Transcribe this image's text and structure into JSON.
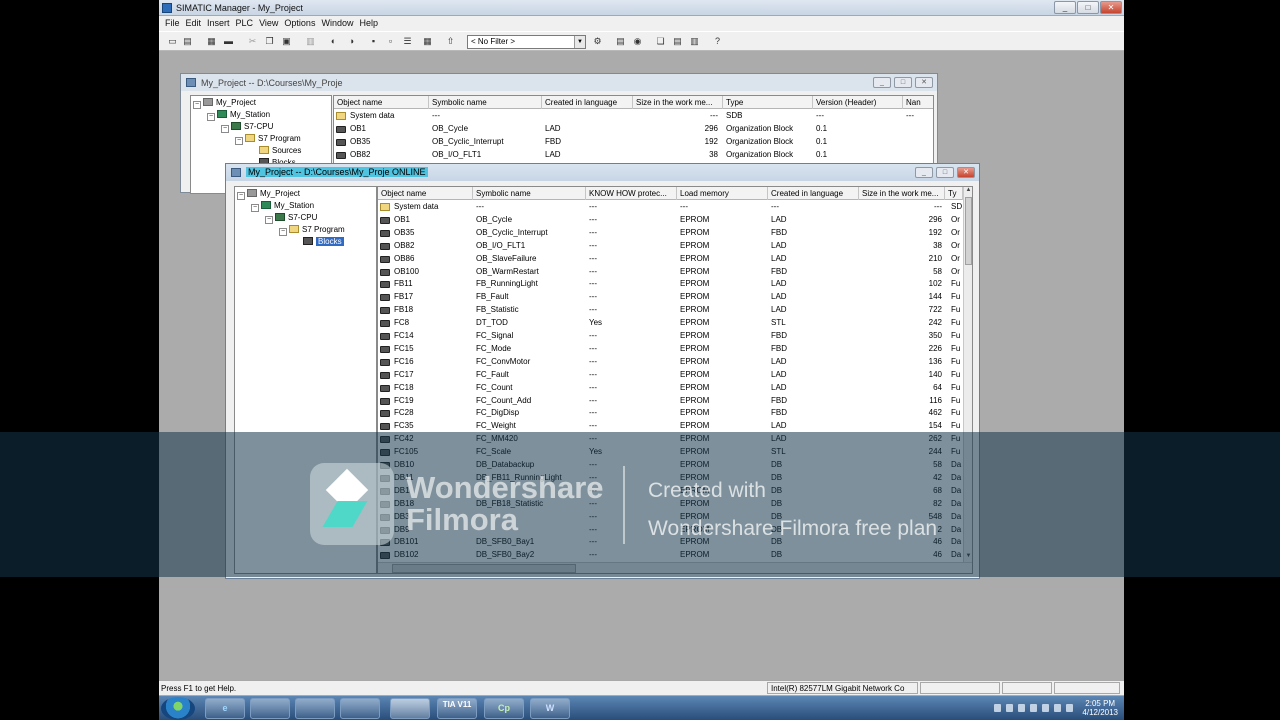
{
  "app": {
    "title": "SIMATIC Manager - My_Project",
    "min": "_",
    "max": "□",
    "close": "✕"
  },
  "menu": [
    "File",
    "Edit",
    "Insert",
    "PLC",
    "View",
    "Options",
    "Window",
    "Help"
  ],
  "toolbar": {
    "filter_value": "< No Filter >",
    "filter_arrow": "▼"
  },
  "offline_window": {
    "title": "My_Project -- D:\\Courses\\My_Proje",
    "tree": [
      "My_Project",
      "My_Station",
      "S7-CPU",
      "S7 Program",
      "Sources",
      "Blocks"
    ],
    "columns": [
      "Object name",
      "Symbolic name",
      "Created in language",
      "Size in the work me...",
      "Type",
      "Version (Header)",
      "Nan"
    ],
    "rows": [
      [
        "System data",
        "---",
        "",
        "---",
        "SDB",
        "---",
        "---"
      ],
      [
        "OB1",
        "OB_Cycle",
        "LAD",
        "296",
        "Organization Block",
        "0.1",
        ""
      ],
      [
        "OB35",
        "OB_Cyclic_Interrupt",
        "FBD",
        "192",
        "Organization Block",
        "0.1",
        ""
      ],
      [
        "OB82",
        "OB_I/O_FLT1",
        "LAD",
        "38",
        "Organization Block",
        "0.1",
        ""
      ]
    ]
  },
  "online_window": {
    "title": "My_Project -- D:\\Courses\\My_Proje  ONLINE",
    "tree": [
      "My_Project",
      "My_Station",
      "S7-CPU",
      "S7 Program",
      "Blocks"
    ],
    "columns": [
      "Object name",
      "Symbolic name",
      "KNOW HOW protec...",
      "Load memory",
      "Created in language",
      "Size in the work me...",
      "Ty"
    ],
    "rows": [
      [
        "System data",
        "---",
        "---",
        "---",
        "---",
        "---",
        "SD"
      ],
      [
        "OB1",
        "OB_Cycle",
        "---",
        "EPROM",
        "LAD",
        "296",
        "Or"
      ],
      [
        "OB35",
        "OB_Cyclic_Interrupt",
        "---",
        "EPROM",
        "FBD",
        "192",
        "Or"
      ],
      [
        "OB82",
        "OB_I/O_FLT1",
        "---",
        "EPROM",
        "LAD",
        "38",
        "Or"
      ],
      [
        "OB86",
        "OB_SlaveFailure",
        "---",
        "EPROM",
        "LAD",
        "210",
        "Or"
      ],
      [
        "OB100",
        "OB_WarmRestart",
        "---",
        "EPROM",
        "FBD",
        "58",
        "Or"
      ],
      [
        "FB11",
        "FB_RunningLight",
        "---",
        "EPROM",
        "LAD",
        "102",
        "Fu"
      ],
      [
        "FB17",
        "FB_Fault",
        "---",
        "EPROM",
        "LAD",
        "144",
        "Fu"
      ],
      [
        "FB18",
        "FB_Statistic",
        "---",
        "EPROM",
        "LAD",
        "722",
        "Fu"
      ],
      [
        "FC8",
        "DT_TOD",
        "Yes",
        "EPROM",
        "STL",
        "242",
        "Fu"
      ],
      [
        "FC14",
        "FC_Signal",
        "---",
        "EPROM",
        "FBD",
        "350",
        "Fu"
      ],
      [
        "FC15",
        "FC_Mode",
        "---",
        "EPROM",
        "FBD",
        "226",
        "Fu"
      ],
      [
        "FC16",
        "FC_ConvMotor",
        "---",
        "EPROM",
        "LAD",
        "136",
        "Fu"
      ],
      [
        "FC17",
        "FC_Fault",
        "---",
        "EPROM",
        "LAD",
        "140",
        "Fu"
      ],
      [
        "FC18",
        "FC_Count",
        "---",
        "EPROM",
        "LAD",
        "64",
        "Fu"
      ],
      [
        "FC19",
        "FC_Count_Add",
        "---",
        "EPROM",
        "FBD",
        "116",
        "Fu"
      ],
      [
        "FC28",
        "FC_DigDisp",
        "---",
        "EPROM",
        "FBD",
        "462",
        "Fu"
      ],
      [
        "FC35",
        "FC_Weight",
        "---",
        "EPROM",
        "LAD",
        "154",
        "Fu"
      ],
      [
        "FC42",
        "FC_MM420",
        "---",
        "EPROM",
        "LAD",
        "262",
        "Fu"
      ],
      [
        "FC105",
        "FC_Scale",
        "Yes",
        "EPROM",
        "STL",
        "244",
        "Fu"
      ],
      [
        "DB10",
        "DB_Databackup",
        "---",
        "EPROM",
        "DB",
        "58",
        "Da"
      ],
      [
        "DB11",
        "DB_FB11_RunningLight",
        "---",
        "EPROM",
        "DB",
        "42",
        "Da"
      ],
      [
        "DB1",
        "",
        "---",
        "EPROM",
        "DB",
        "68",
        "Da"
      ],
      [
        "DB18",
        "DB_FB18_Statistic",
        "---",
        "EPROM",
        "DB",
        "82",
        "Da"
      ],
      [
        "DB3",
        "",
        "---",
        "EPROM",
        "DB",
        "548",
        "Da"
      ],
      [
        "DB9",
        "",
        "---",
        "EPROM",
        "DB",
        "2",
        "Da"
      ],
      [
        "DB101",
        "DB_SFB0_Bay1",
        "---",
        "EPROM",
        "DB",
        "46",
        "Da"
      ],
      [
        "DB102",
        "DB_SFB0_Bay2",
        "---",
        "EPROM",
        "DB",
        "46",
        "Da"
      ]
    ]
  },
  "status": {
    "left": "Press F1 to get Help.",
    "network": "Intel(R) 82577LM Gigabit Network Co"
  },
  "taskbar": {
    "apps": [
      "e",
      "",
      "",
      "",
      "",
      "TIA V11",
      "Cp",
      "W"
    ],
    "time": "2:05 PM",
    "date": "4/12/2013"
  },
  "watermark": {
    "brand_line1": "Wondershare",
    "brand_line2": "Filmora",
    "note_line1": "Created with",
    "note_line2": "Wondershare Filmora free plan"
  },
  "colors": {
    "desktop": "#ababab",
    "selection": "#316ac5",
    "online_caption": "#4ec4e0",
    "watermark_band": "#143448"
  }
}
